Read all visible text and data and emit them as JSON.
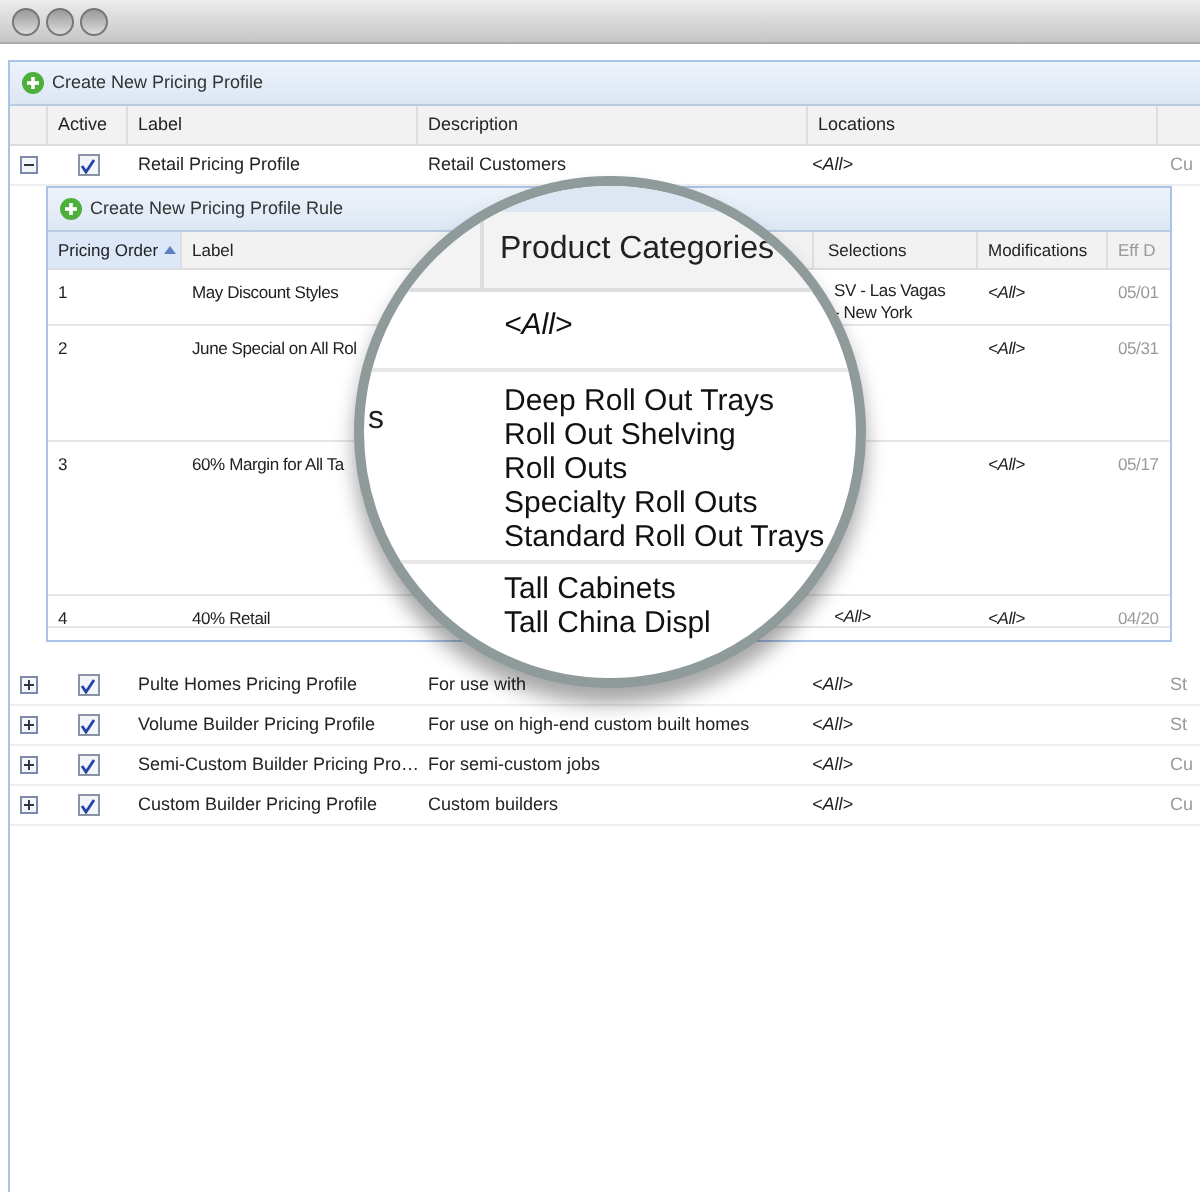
{
  "profiles": {
    "toolbar": {
      "label": "Create New Pricing Profile"
    },
    "columns": [
      "Active",
      "Label",
      "Description",
      "Locations"
    ],
    "rows": [
      {
        "expanded": true,
        "active": true,
        "label": "Retail Pricing Profile",
        "description": "Retail Customers",
        "locations": "<All>",
        "column_5": "Cu"
      },
      {
        "expanded": false,
        "active": true,
        "label": "Pulte Homes Pricing Profile",
        "description": "For use with",
        "locations": "<All>",
        "column_5": "St"
      },
      {
        "expanded": false,
        "active": true,
        "label": "Volume Builder Pricing Profile",
        "description": "For use on high-end custom built homes",
        "locations": "<All>",
        "column_5": "St"
      },
      {
        "expanded": false,
        "active": true,
        "label": "Semi-Custom Builder Pricing Pro…",
        "description": "For semi-custom jobs",
        "locations": "<All>",
        "column_5": "Cu"
      },
      {
        "expanded": false,
        "active": true,
        "label": "Custom Builder Pricing Profile",
        "description": "Custom builders",
        "locations": "<All>",
        "column_5": "Cu"
      }
    ]
  },
  "rules": {
    "toolbar": {
      "label": "Create New Pricing Profile Rule"
    },
    "columns": [
      {
        "label": "Pricing Order",
        "sorted": true
      },
      {
        "label": "Label",
        "sorted": false
      },
      {
        "label": "Selections",
        "sorted": false
      },
      {
        "label": "Modifications",
        "sorted": false
      },
      {
        "label": "Eff D",
        "sorted": false
      }
    ],
    "rows": [
      {
        "order": "1",
        "label": "May Discount Styles",
        "selections": [
          "SV - Las Vagas",
          "- New York"
        ],
        "modifications": "<All>",
        "eff_date": "05/01"
      },
      {
        "order": "2",
        "label": "June Special on All Rol",
        "selections": [],
        "modifications": "<All>",
        "eff_date": "05/31"
      },
      {
        "order": "3",
        "label": "60% Margin for All Ta",
        "selections": [],
        "modifications": "<All>",
        "eff_date": "05/17"
      },
      {
        "order": "4",
        "label": "40% Retail",
        "selections": [
          "<All>"
        ],
        "modifications": "<All>",
        "eff_date": "04/20"
      }
    ]
  },
  "magnifier": {
    "header": "Product Categories",
    "rows": [
      {
        "label_fragment": "",
        "categories": [
          "<All>"
        ]
      },
      {
        "label_fragment": "s",
        "categories": [
          "Deep Roll Out Trays",
          "Roll Out Shelving",
          "Roll Outs",
          "Specialty Roll Outs",
          "Standard Roll Out Trays"
        ]
      },
      {
        "label_fragment": "",
        "categories": [
          "Tall Cabinets",
          "Tall China Displ"
        ]
      }
    ]
  }
}
